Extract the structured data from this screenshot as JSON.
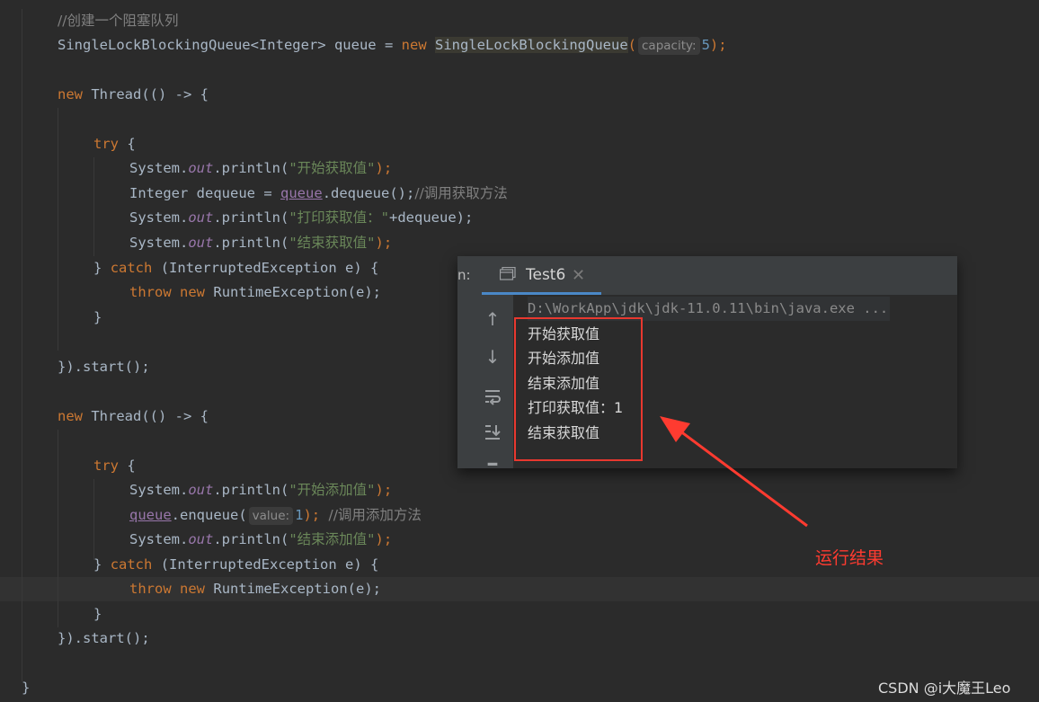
{
  "code": {
    "comment_create": "//创建一个阻塞队列",
    "queue_type": "SingleLockBlockingQueue<Integer>",
    "queue_var": "queue",
    "eq": "=",
    "kw_new": "new",
    "queue_ctor": "SingleLockBlockingQueue",
    "hint_capacity": "capacity:",
    "capacity_value": "5",
    "thread_open": "Thread(() -> {",
    "kw_try": "try",
    "brace_open": "{",
    "system": "System.",
    "out": "out",
    "println_open": ".println(",
    "close_paren_semi": ");",
    "str_start_get": "\"开始获取值\"",
    "integer_dequeue": "Integer dequeue",
    "dequeue_call": ".dequeue();",
    "comment_dequeue": "//调用获取方法",
    "str_print_get": "\"打印获取值：\"",
    "plus_dequeue": "+dequeue);",
    "str_end_get": "\"结束获取值\"",
    "catch_close": "}",
    "kw_catch": "catch",
    "catch_params": "(InterruptedException e) {",
    "kw_throw": "throw",
    "runtime_exc": "RuntimeException(e);",
    "close_brace": "}",
    "start_call": "}).start();",
    "str_start_add": "\"开始添加值\"",
    "enqueue_call": ".enqueue(",
    "hint_value": "value:",
    "enqueue_value": "1",
    "comment_enqueue": "//调用添加方法",
    "str_end_add": "\"结束添加值\"",
    "final_brace": "}"
  },
  "run_panel": {
    "prefix": "n:",
    "tab_label": "Test6",
    "tab_close": "✕",
    "command": "D:\\WorkApp\\jdk\\jdk-11.0.11\\bin\\java.exe ...",
    "output_lines": [
      "开始获取值",
      "开始添加值",
      "结束添加值",
      "打印获取值：1",
      "结束获取值"
    ]
  },
  "annotation": {
    "text": "运行结果",
    "color": "#ff3b30"
  },
  "watermark": "CSDN @i大魔王Leo",
  "colors": {
    "background": "#2b2b2b",
    "keyword": "#cc7832",
    "string": "#6a8759",
    "field": "#9876aa",
    "number": "#6897bb",
    "comment": "#808080",
    "highlight_box": "#e8382f"
  }
}
